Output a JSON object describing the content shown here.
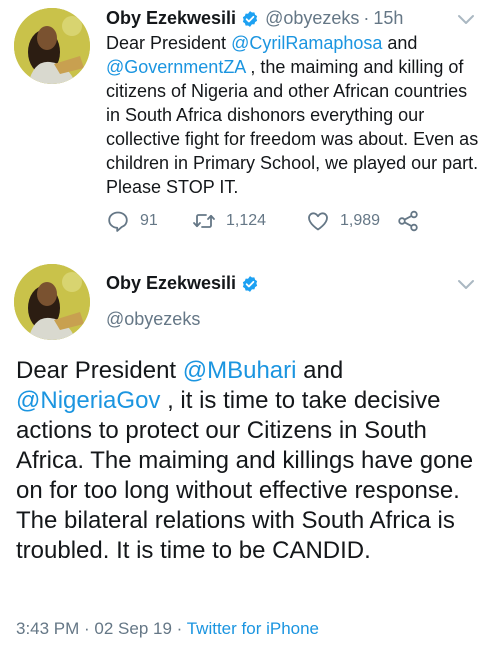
{
  "tweets": [
    {
      "name": "Oby Ezekwesili",
      "handle": "@obyezeks",
      "dot": "·",
      "time": "15h",
      "text_parts": {
        "p1": "Dear President ",
        "m1": "@CyrilRamaphosa",
        "p2": " and ",
        "m2": "@GovernmentZA",
        "p3": " , the maiming and killing of citizens of Nigeria and other African countries in South Africa dishonors everything our collective fight for freedom was about. Even as children in Primary School, we played our part. Please STOP IT."
      },
      "replies": "91",
      "retweets": "1,124",
      "likes": "1,989"
    },
    {
      "name": "Oby Ezekwesili",
      "handle": "@obyezeks",
      "text_parts": {
        "p1": "Dear President ",
        "m1": "@MBuhari",
        "p2": " and ",
        "m2": "@NigeriaGov",
        "p3": " , it is time to take decisive actions to protect our Citizens in South Africa. The maiming and killings have gone on for too long without effective response. The bilateral relations with South Africa is troubled. It is time to be CANDID."
      },
      "meta_time": "3:43 PM · 02 Sep 19 · ",
      "meta_source": "Twitter for iPhone"
    }
  ],
  "colors": {
    "link": "#1b95e0",
    "muted": "#657786",
    "verified": "#1da1f2"
  },
  "icons": [
    "verified-badge-icon",
    "chevron-down-icon",
    "reply-icon",
    "retweet-icon",
    "like-icon",
    "share-icon"
  ]
}
